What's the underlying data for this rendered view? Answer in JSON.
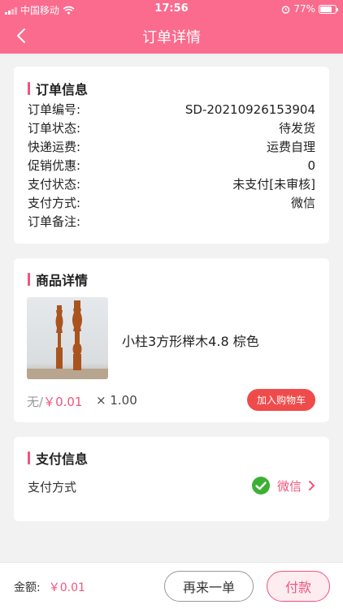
{
  "status_bar": {
    "carrier": "中国移动",
    "time": "17:56",
    "battery": "77%"
  },
  "nav": {
    "title": "订单详情"
  },
  "order_info": {
    "title": "订单信息",
    "rows": [
      {
        "label": "订单编号:",
        "value": "SD-20210926153904"
      },
      {
        "label": "订单状态:",
        "value": "待发货"
      },
      {
        "label": "快递运费:",
        "value": "运费自理"
      },
      {
        "label": "促销优惠:",
        "value": "0"
      },
      {
        "label": "支付状态:",
        "value": "未支付[未审核]"
      },
      {
        "label": "支付方式:",
        "value": "微信"
      },
      {
        "label": "订单备注:",
        "value": ""
      }
    ]
  },
  "product": {
    "title": "商品详情",
    "name": "小柱3方形榉木4.8 棕色",
    "price_prefix": "无/",
    "price": "￥0.01",
    "quantity": "× 1.00",
    "add_to_cart": "加入购物车"
  },
  "payment": {
    "title": "支付信息",
    "label": "支付方式",
    "method": "微信"
  },
  "footer": {
    "amount_label": "金额:",
    "amount": "￥0.01",
    "reorder": "再来一单",
    "pay": "付款"
  },
  "colors": {
    "header": "#fb6b8e",
    "accent": "#f0557d",
    "cart_button": "#f04b4b",
    "wechat": "#3cb034"
  }
}
